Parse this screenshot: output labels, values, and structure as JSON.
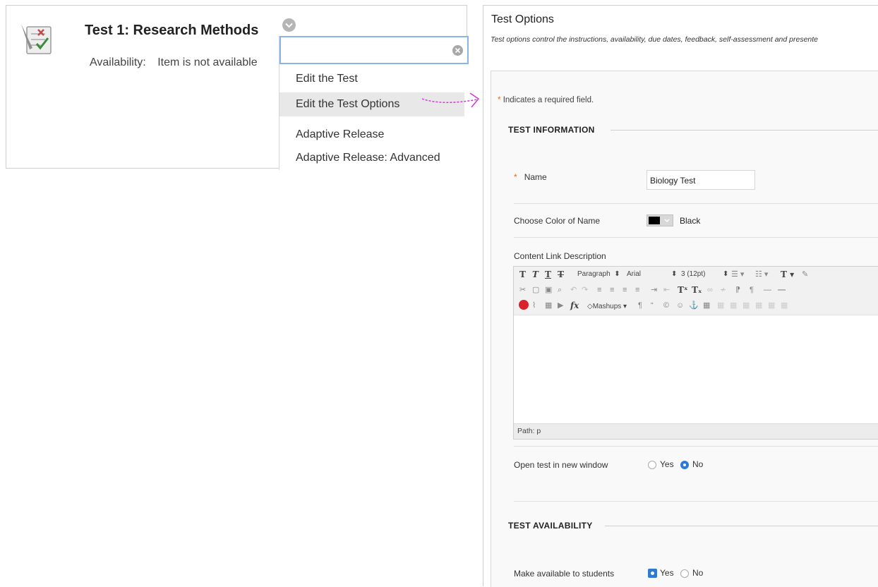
{
  "left": {
    "title": "Test 1: Research Methods",
    "availability_label": "Availability:",
    "availability_value": "Item is not available",
    "menu_items": [
      "Edit the Test",
      "Edit the Test Options",
      "Adaptive Release",
      "Adaptive Release: Advanced"
    ],
    "active_item": "Edit the Test Options"
  },
  "right": {
    "page_title": "Test Options",
    "page_desc": "Test options control the instructions, availability, due dates, feedback, self-assessment and presente",
    "required_star": "*",
    "required_note": "Indicates a required field.",
    "section_info": "TEST INFORMATION",
    "name_label": "Name",
    "name_value": "Biology Test",
    "color_label": "Choose Color of Name",
    "color_value": "Black",
    "content_label": "Content Link Description",
    "toolbar": {
      "paragraph": "Paragraph",
      "font": "Arial",
      "size": "3 (12pt)",
      "mashups": "Mashups"
    },
    "path_text": "Path: p",
    "open_window_label": "Open test in new window",
    "yes": "Yes",
    "no": "No",
    "section_avail": "TEST AVAILABILITY",
    "make_available_label": "Make available to students"
  },
  "colors": {
    "accent": "#2e7bd6",
    "required": "#e36a1b",
    "arrow": "#d12fd9",
    "search_border": "#8ab4e6"
  },
  "icons": [
    "test-icon",
    "chevron-down-icon",
    "clear-icon",
    "arrow-icon"
  ]
}
